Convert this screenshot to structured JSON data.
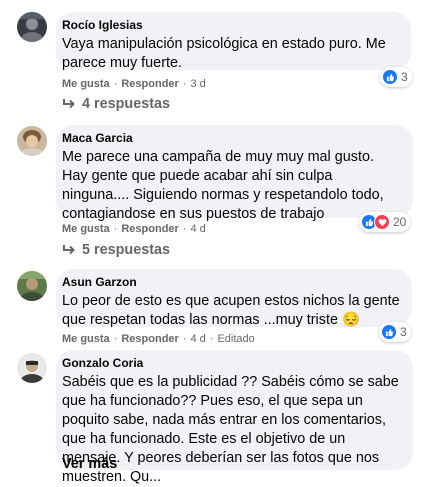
{
  "comments": [
    {
      "author": "Rocío Iglesias",
      "text": "Vaya manipulación psicológica en estado puro. Me parece muy fuerte.",
      "like": "Me gusta",
      "reply": "Responder",
      "time": "3 d",
      "reaction_count": "3",
      "replies_label": "4 respuestas"
    },
    {
      "author": "Maca Garcia",
      "text": "Me parece una campaña de muy muy mal gusto. Hay gente que puede acabar ahí sin culpa ninguna.... Siguiendo normas y respetandolo todo, contagiandose en sus puestos de trabajo",
      "like": "Me gusta",
      "reply": "Responder",
      "time": "4 d",
      "reaction_count": "20",
      "replies_label": "5 respuestas"
    },
    {
      "author": "Asun Garzon",
      "text": "Lo peor de esto es que acupen estos nichos la gente que respetan todas las normas ...muy triste 😔",
      "like": "Me gusta",
      "reply": "Responder",
      "time": "4 d",
      "edited": "Editado",
      "reaction_count": "3"
    },
    {
      "author": "Gonzalo Coria",
      "text": "Sabéis que es la publicidad ?? Sabéis cómo se sabe que ha funcionado?? Pues eso, el que sepa un poquito sabe, nada más entrar en los comentarios, que ha funcionado. Este es el objetivo de un mensaje. Y peores deberían ser las fotos que nos muestren. Qu...",
      "see_more": "Ver más"
    }
  ],
  "separator": "·",
  "icons": {
    "like": "thumbs-up-icon",
    "love": "heart-icon",
    "reply_arrow": "reply-arrow-icon"
  },
  "colors": {
    "bubble": "#f0f2f5",
    "like_blue": "#1877f2",
    "love_red": "#f33e58",
    "secondary_text": "#65676b"
  }
}
